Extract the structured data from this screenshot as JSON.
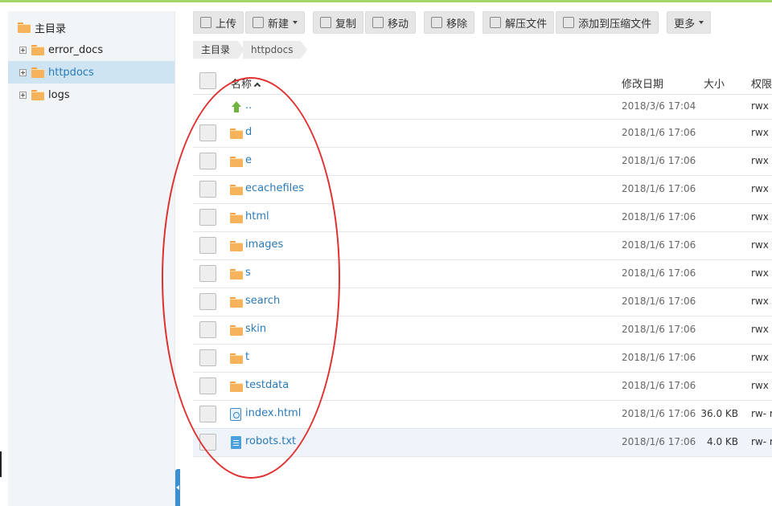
{
  "sidebar": {
    "root": "主目录",
    "items": [
      {
        "label": "error_docs"
      },
      {
        "label": "httpdocs"
      },
      {
        "label": "logs"
      }
    ]
  },
  "toolbar": {
    "upload": "上传",
    "new": "新建",
    "copy": "复制",
    "move": "移动",
    "remove": "移除",
    "extract": "解压文件",
    "add_to_archive": "添加到压缩文件",
    "more": "更多"
  },
  "breadcrumb": [
    "主目录",
    "httpdocs"
  ],
  "table": {
    "columns": {
      "name": "名称",
      "date": "修改日期",
      "size": "大小",
      "perm": "权限"
    },
    "rows": [
      {
        "name": "..",
        "date": "2018/3/6 17:04",
        "size": "",
        "perm": "rwx"
      },
      {
        "name": "d",
        "date": "2018/1/6 17:06",
        "size": "",
        "perm": "rwx"
      },
      {
        "name": "e",
        "date": "2018/1/6 17:06",
        "size": "",
        "perm": "rwx"
      },
      {
        "name": "ecachefiles",
        "date": "2018/1/6 17:06",
        "size": "",
        "perm": "rwx"
      },
      {
        "name": "html",
        "date": "2018/1/6 17:06",
        "size": "",
        "perm": "rwx"
      },
      {
        "name": "images",
        "date": "2018/1/6 17:06",
        "size": "",
        "perm": "rwx"
      },
      {
        "name": "s",
        "date": "2018/1/6 17:06",
        "size": "",
        "perm": "rwx"
      },
      {
        "name": "search",
        "date": "2018/1/6 17:06",
        "size": "",
        "perm": "rwx"
      },
      {
        "name": "skin",
        "date": "2018/1/6 17:06",
        "size": "",
        "perm": "rwx"
      },
      {
        "name": "t",
        "date": "2018/1/6 17:06",
        "size": "",
        "perm": "rwx"
      },
      {
        "name": "testdata",
        "date": "2018/1/6 17:06",
        "size": "",
        "perm": "rwx"
      },
      {
        "name": "index.html",
        "date": "2018/1/6 17:06",
        "size": "36.0 KB",
        "perm": "rw- r"
      },
      {
        "name": "robots.txt",
        "date": "2018/1/6 17:06",
        "size": "4.0 KB",
        "perm": "rw- r"
      }
    ]
  },
  "colors": {
    "accent": "#2a7ab8",
    "folder": "#f7b35b",
    "annotation": "#e03030",
    "top_bar": "#a6d66a"
  }
}
